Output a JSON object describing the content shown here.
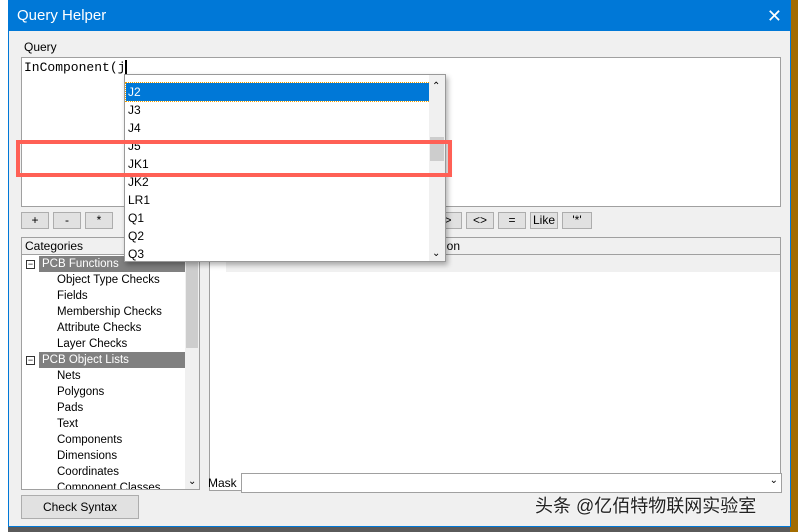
{
  "window": {
    "title": "Query Helper",
    "close_icon": "close-icon"
  },
  "query": {
    "label": "Query",
    "value": "InComponent(j"
  },
  "operators": [
    "+",
    "-",
    "*",
    ">",
    "<>",
    "=",
    "Like",
    "'*'"
  ],
  "autocomplete": {
    "items": [
      "J2",
      "J3",
      "J4",
      "J5",
      "JK1",
      "JK2",
      "LR1",
      "Q1",
      "Q2",
      "Q3"
    ],
    "selected": "J2"
  },
  "categories": {
    "header": "Categories",
    "groups": [
      {
        "label": "PCB Functions",
        "items": [
          "Object Type Checks",
          "Fields",
          "Membership Checks",
          "Attribute Checks",
          "Layer Checks"
        ]
      },
      {
        "label": "PCB Object Lists",
        "items": [
          "Nets",
          "Polygons",
          "Pads",
          "Text",
          "Components",
          "Dimensions",
          "Coordinates",
          "Component Classes"
        ]
      }
    ]
  },
  "details": {
    "header": "Description"
  },
  "mask": {
    "label": "Mask",
    "value": ""
  },
  "check_syntax": "Check Syntax",
  "watermark": "头条 @亿佰特物联网实验室",
  "colors": {
    "titlebar": "#0078d7",
    "highlight": "#ff6055",
    "selection": "#0078d7"
  }
}
